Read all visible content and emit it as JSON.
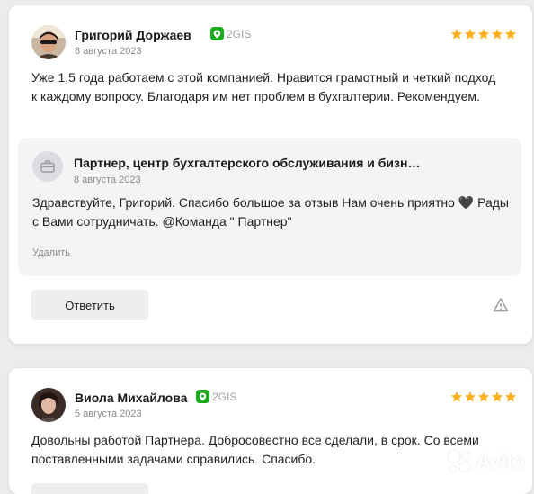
{
  "colors": {
    "star": "#ffb021",
    "source_badge": "#19aa1e",
    "secondary_text": "#8a8a8a"
  },
  "reviews": [
    {
      "author": "Григорий Доржаев",
      "source": "2GIS",
      "source_icon": "2gis-icon",
      "date": "8 августа 2023",
      "rating": 5,
      "text": "Уже 1,5 года работаем с этой компанией. Нравится грамотный и четкий подход к каждому вопросу. Благодаря им нет проблем в бухгалтерии. Рекомендуем.",
      "reply": {
        "icon": "briefcase-icon",
        "name": "Партнер, центр бухгалтерского обслуживания и бизн…",
        "date": "8 августа 2023",
        "text": "Здравствуйте, Григорий. Спасибо большое за отзыв    Нам очень приятно 🖤 Рады с Вами сотрудничать. @Команда \" Партнер\"",
        "delete_label": "Удалить"
      },
      "answer_button": "Ответить",
      "report_icon": "warning-icon"
    },
    {
      "author": "Виола Михайлова",
      "source": "2GIS",
      "source_icon": "2gis-icon",
      "date": "5 августа 2023",
      "rating": 5,
      "text": "Довольны работой Партнера. Добросовестно все сделали, в срок. Со всеми поставленными задачами справились. Спасибо."
    }
  ],
  "watermark": {
    "text": "Avito",
    "icon": "avito-logo-icon"
  }
}
